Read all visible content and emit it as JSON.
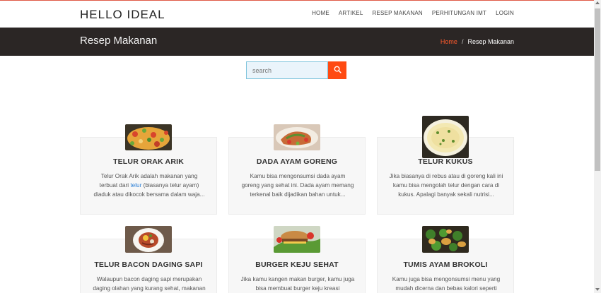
{
  "navbar": {
    "brand": "HELLO IDEAL",
    "links": [
      "HOME",
      "ARTIKEL",
      "RESEP MAKANAN",
      "PERHITUNGAN IMT",
      "LOGIN"
    ]
  },
  "banner": {
    "title": "Resep Makanan",
    "breadcrumb": {
      "home": "Home",
      "separator": "/",
      "current": "Resep Makanan"
    }
  },
  "search": {
    "placeholder": "search"
  },
  "colors": {
    "accent": "#ff4a12",
    "banner_bg": "#2b2625",
    "link": "#2a7fd6"
  },
  "cards": [
    {
      "title": "TELUR ORAK ARIK",
      "desc_before": "Telur Orak Arik adalah makanan yang terbuat dari ",
      "desc_link": "telur",
      "desc_after": " (biasanya telur ayam) diaduk atau dikocok bersama dalam waja..."
    },
    {
      "title": "DADA AYAM GORENG",
      "desc": "Kamu bisa mengonsumsi dada ayam goreng yang sehat ini. Dada ayam memang terkenal baik dijadikan bahan untuk..."
    },
    {
      "title": "TELUR KUKUS",
      "desc": "Jika biasanya di rebus atau di goreng kali ini kamu bisa mengolah telur dengan cara di kukus. Apalagi banyak sekali nutrisi..."
    },
    {
      "title": "TELUR BACON DAGING SAPI",
      "desc": "Walaupun bacon daging sapi merupakan daging olahan yang kurang sehat, makanan"
    },
    {
      "title": "BURGER KEJU SEHAT",
      "desc": "Jika kamu kangen makan burger, kamu juga bisa membuat burger keju kreasi"
    },
    {
      "title": "TUMIS AYAM BROKOLI",
      "desc": "Kamu juga bisa mengonsumsi menu yang mudah dicerna dan bebas kalori seperti"
    }
  ]
}
